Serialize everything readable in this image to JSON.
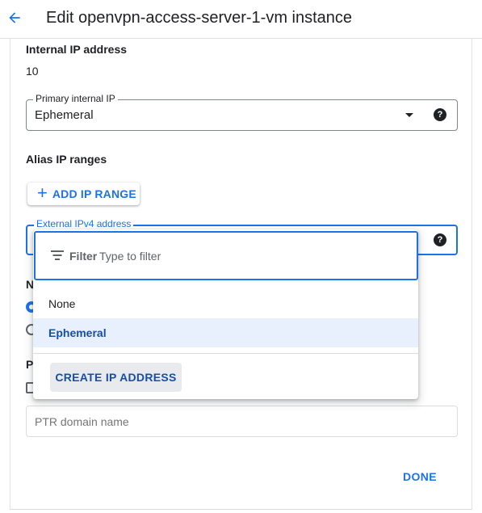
{
  "header": {
    "title": "Edit openvpn-access-server-1-vm instance",
    "back_icon": "arrow-back-icon"
  },
  "internal_ip": {
    "label": "Internal IP address",
    "value": "10"
  },
  "primary_internal_ip": {
    "label": "Primary internal IP",
    "value": "Ephemeral",
    "help": "?"
  },
  "alias_ip": {
    "label": "Alias IP ranges",
    "add_button": "ADD IP RANGE",
    "add_icon": "+"
  },
  "external_ipv4": {
    "label": "External IPv4 address",
    "help": "?"
  },
  "obscured": {
    "network_tier_fragment": "N",
    "public_dns_fragment": "Pu"
  },
  "ptr": {
    "placeholder": "PTR domain name"
  },
  "done_button": "DONE",
  "dropdown": {
    "filter_label": "Filter",
    "filter_placeholder": "Type to filter",
    "options": [
      "None",
      "Ephemeral"
    ],
    "selected": "Ephemeral",
    "create_button": "CREATE IP ADDRESS"
  },
  "colors": {
    "accent": "#1a73e8",
    "selected_bg": "#e8f0fe",
    "selected_text": "#174ea6"
  }
}
